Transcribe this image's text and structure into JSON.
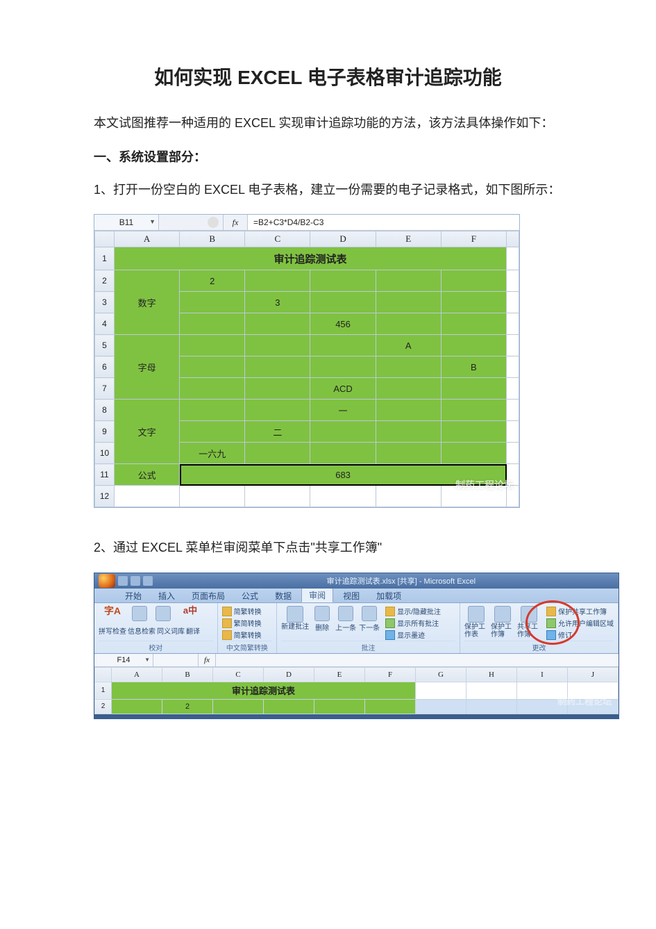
{
  "doc": {
    "title": "如何实现 EXCEL 电子表格审计追踪功能",
    "intro": "本文试图推荐一种适用的 EXCEL 实现审计追踪功能的方法，该方法具体操作如下：",
    "section1_head": "一、系统设置部分：",
    "step1": "1、打开一份空白的 EXCEL 电子表格，建立一份需要的电子记录格式，如下图所示：",
    "step2": "2、通过 EXCEL 菜单栏审阅菜单下点击\"共享工作簿\""
  },
  "ss1": {
    "namebox": "B11",
    "fx_label": "fx",
    "formula": "=B2+C3*D4/B2-C3",
    "cols": [
      "A",
      "B",
      "C",
      "D",
      "E",
      "F"
    ],
    "rows": [
      "1",
      "2",
      "3",
      "4",
      "5",
      "6",
      "7",
      "8",
      "9",
      "10",
      "11",
      "12"
    ],
    "title_row": "审计追踪测试表",
    "labels": {
      "numbers": "数字",
      "letters": "字母",
      "text": "文字",
      "formula": "公式"
    },
    "cells": {
      "B2": "2",
      "C3": "3",
      "D4": "456",
      "E5": "A",
      "F6": "B",
      "D7": "ACD",
      "D8": "一",
      "C9": "二",
      "B10": "一六九",
      "B11": "683"
    },
    "watermark": "制药工程论坛"
  },
  "ss2": {
    "window_title": "审计追踪测试表.xlsx [共享] - Microsoft Excel",
    "tabs": [
      "开始",
      "插入",
      "页面布局",
      "公式",
      "数据",
      "审阅",
      "视图",
      "加载项"
    ],
    "active_tab": "审阅",
    "group_proof": {
      "items": [
        "拼写检查",
        "信息检索",
        "同义词库",
        "翻译"
      ],
      "name_area": "校对",
      "char_icon": "字A",
      "azhong": "a中"
    },
    "group_cjk": {
      "items": [
        "简繁转换",
        "繁简转换",
        "简繁转换"
      ],
      "name": "中文简繁转换"
    },
    "group_comments": {
      "big": "新建批注",
      "nav": [
        "删除",
        "上一条",
        "下一条"
      ],
      "right": [
        "显示/隐藏批注",
        "显示所有批注",
        "显示墨迹"
      ],
      "name": "批注"
    },
    "group_changes": {
      "big": [
        "保护工作表",
        "保护工作簿",
        "共享工作簿"
      ],
      "right": [
        "保护共享工作簿",
        "允许用户编辑区域",
        "修订"
      ],
      "name": "更改"
    },
    "fbar": {
      "namebox": "F14",
      "fx": "fx"
    },
    "sheet": {
      "cols": [
        "A",
        "B",
        "C",
        "D",
        "E",
        "F",
        "G",
        "H",
        "I",
        "J"
      ],
      "rows": [
        "1",
        "2"
      ],
      "title_row": "审计追踪测试表",
      "B2": "2"
    },
    "watermark": "制药工程论坛"
  }
}
